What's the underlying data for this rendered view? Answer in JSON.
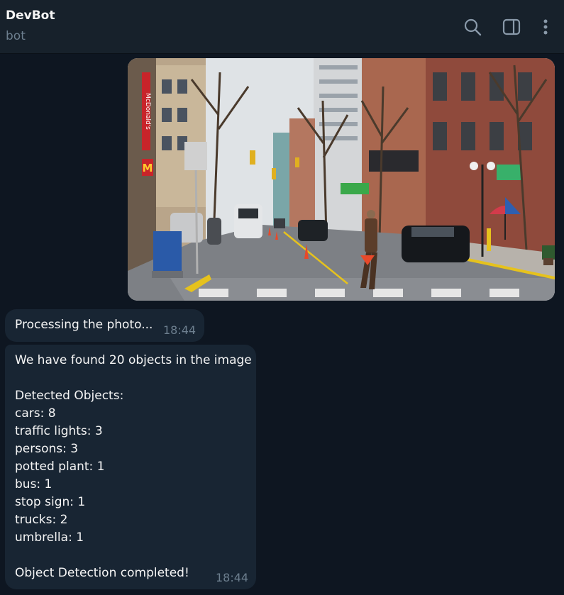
{
  "header": {
    "title": "DevBot",
    "subtitle": "bot",
    "icons": [
      "search-icon",
      "sidebar-toggle-icon",
      "more-vertical-icon"
    ]
  },
  "messages": {
    "photo": {
      "storefront_sign": "McDonald's"
    },
    "processing": {
      "text": "Processing the photo...",
      "time": "18:44"
    },
    "result": {
      "summary": "We have found 20 objects in the image",
      "heading": "Detected Objects:",
      "objects": [
        "cars: 8",
        "traffic lights: 3",
        "persons: 3",
        "potted plant: 1",
        "bus: 1",
        "stop sign: 1",
        "trucks: 2",
        "umbrella: 1"
      ],
      "footer": "Object Detection completed!",
      "time": "18:44"
    }
  },
  "colors": {
    "background": "#0e1621",
    "header": "#17212b",
    "bubble": "#182533",
    "muted_text": "#6d7f8f"
  }
}
